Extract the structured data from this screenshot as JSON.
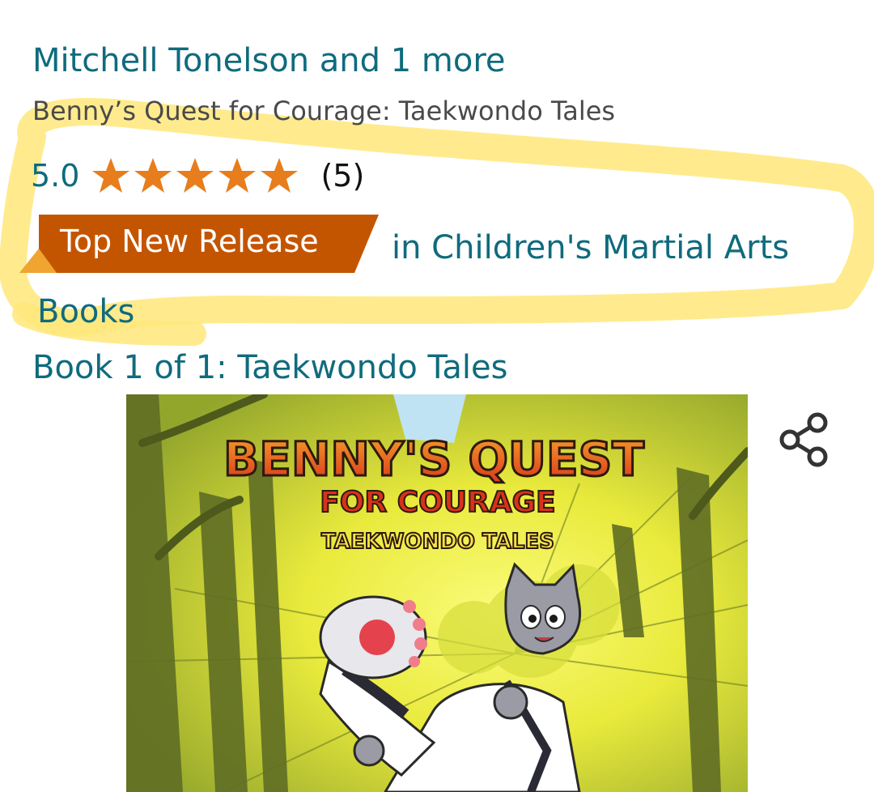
{
  "product": {
    "author_line": "Mitchell Tonelson and 1 more",
    "title": "Benny’s Quest for Courage: Taekwondo Tales",
    "rating": {
      "value": "5.0",
      "stars": 5,
      "max_stars": 5,
      "count": "(5)"
    },
    "badge": {
      "label": "Top New Release",
      "category_line1": "in Children's Martial Arts",
      "category_line2": "Books"
    },
    "series": "Book 1 of 1: Taekwondo Tales"
  },
  "cover": {
    "title_line1": "BENNY'S QUEST",
    "title_line2": "FOR COURAGE",
    "title_line3": "TAEKWONDO TALES"
  },
  "icons": {
    "share": "share-icon",
    "star": "star-icon"
  },
  "colors": {
    "link": "#0f6b7d",
    "star": "#e77d1c",
    "badge": "#c45500",
    "highlight": "#ffe77a"
  }
}
